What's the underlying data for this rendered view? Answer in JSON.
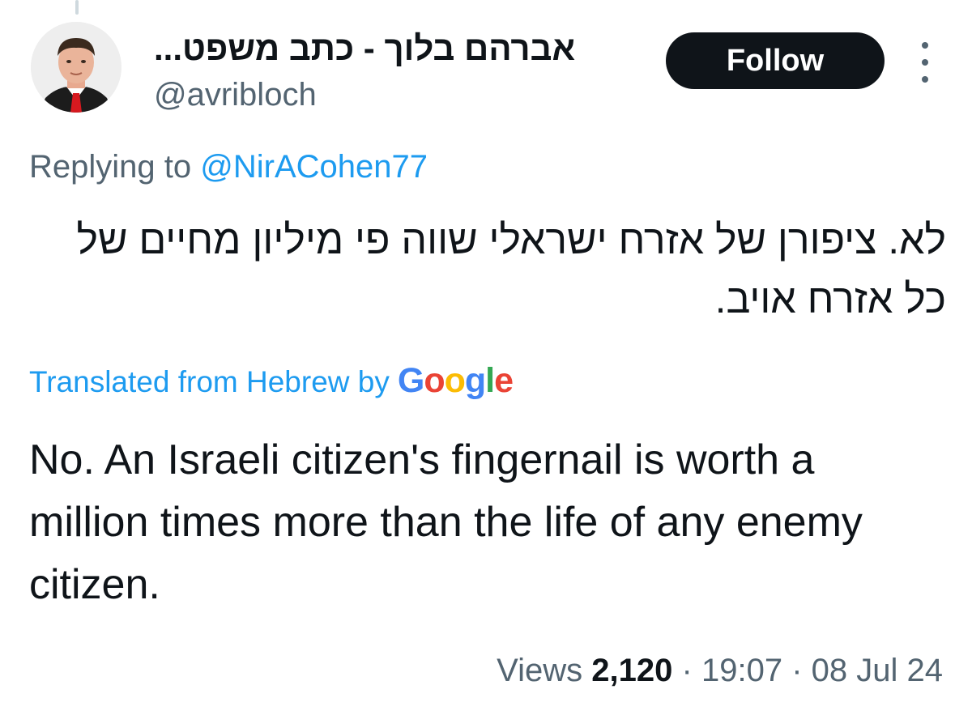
{
  "tweet": {
    "author": {
      "display_name": "אברהם בלוך - כתב משפט...",
      "handle": "@avribloch"
    },
    "follow_label": "Follow",
    "more_icon": "more-vertical-icon",
    "replying": {
      "prefix": "Replying to",
      "handle": "@NirACohen77"
    },
    "original_text": "לא. ציפורן של אזרח ישראלי שווה פי מיליון מחיים של כל אזרח אויב.",
    "translation": {
      "label": "Translated from Hebrew by",
      "provider": {
        "g1": "G",
        "o1": "o",
        "o2": "o",
        "g2": "g",
        "l": "l",
        "e": "e"
      }
    },
    "translated_text": "No. An Israeli citizen's fingernail is worth a million times more than the life of any enemy citizen.",
    "meta": {
      "views_label": "Views",
      "views_count": "2,120",
      "separator": "·",
      "time": "19:07",
      "date": "08 Jul 24"
    }
  },
  "colors": {
    "text": "#0f1419",
    "secondary": "#536471",
    "link": "#1d9bf0",
    "follow_bg": "#0f1419",
    "follow_text": "#ffffff"
  }
}
